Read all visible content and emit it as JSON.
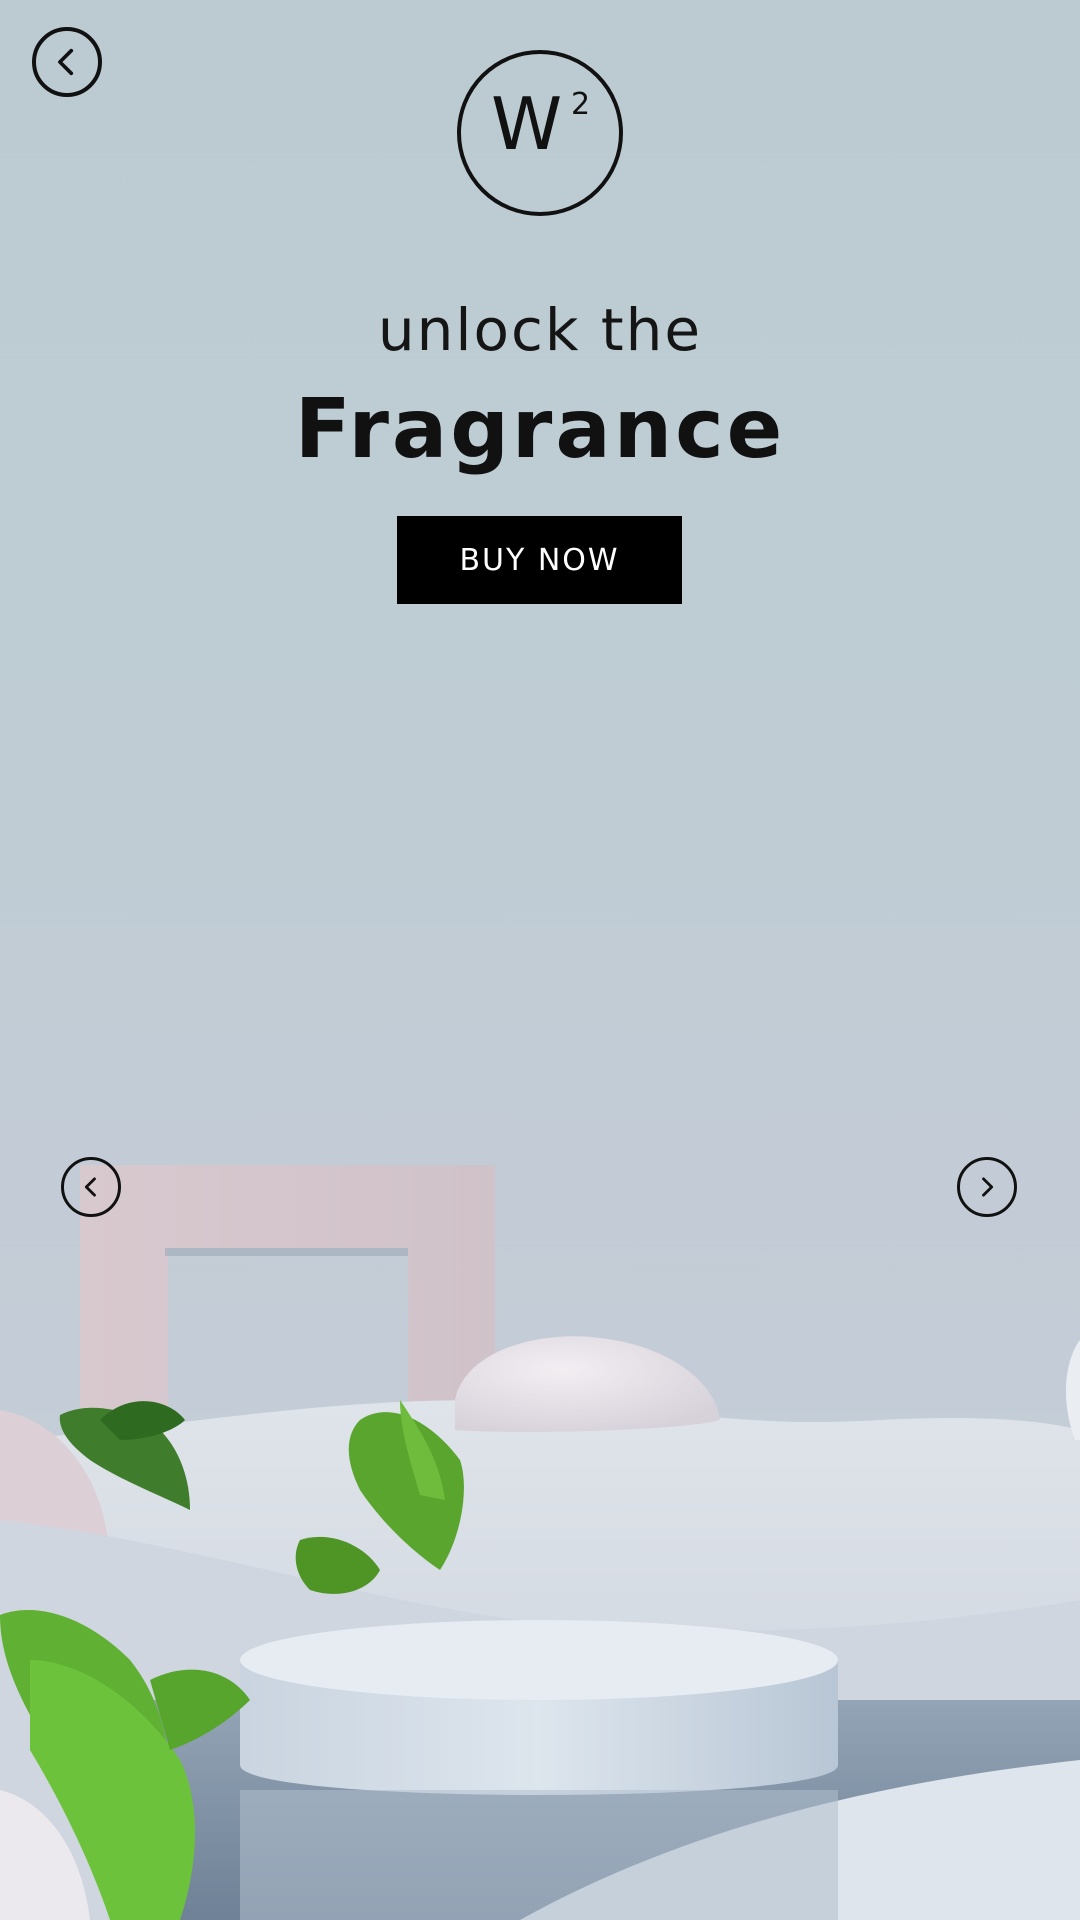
{
  "nav": {
    "back_icon": "chevron-left-icon"
  },
  "brand": {
    "logo_letter": "W",
    "logo_superscript": "2"
  },
  "hero": {
    "tagline": "unlock the",
    "headline": "Fragrance",
    "cta_label": "BUY NOW"
  },
  "carousel": {
    "prev_icon": "chevron-left-icon",
    "next_icon": "chevron-right-icon"
  },
  "colors": {
    "background": "#bfccd4",
    "text": "#111111",
    "cta_background": "#000000",
    "cta_text": "#ffffff"
  }
}
